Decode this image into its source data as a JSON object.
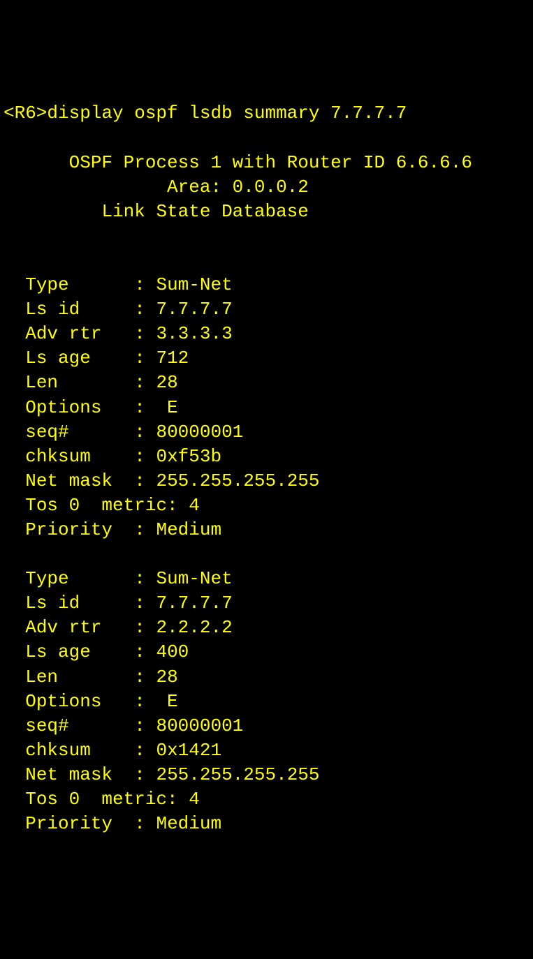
{
  "prompt": "<R6>display ospf lsdb summary 7.7.7.7",
  "header": {
    "process": "OSPF Process 1 with Router ID 6.6.6.6",
    "area": "Area: 0.0.0.2",
    "title": "Link State Database"
  },
  "entries": [
    {
      "type_label": "Type",
      "type_value": "Sum-Net",
      "lsid_label": "Ls id",
      "lsid_value": "7.7.7.7",
      "advrtr_label": "Adv rtr",
      "advrtr_value": "3.3.3.3",
      "lsage_label": "Ls age",
      "lsage_value": "712",
      "len_label": "Len",
      "len_value": "28",
      "options_label": "Options",
      "options_value": " E",
      "seq_label": "seq#",
      "seq_value": "80000001",
      "chksum_label": "chksum",
      "chksum_value": "0xf53b",
      "netmask_label": "Net mask",
      "netmask_value": "255.255.255.255",
      "tos_label": "Tos 0  metric: 4",
      "priority_label": "Priority",
      "priority_value": "Medium"
    },
    {
      "type_label": "Type",
      "type_value": "Sum-Net",
      "lsid_label": "Ls id",
      "lsid_value": "7.7.7.7",
      "advrtr_label": "Adv rtr",
      "advrtr_value": "2.2.2.2",
      "lsage_label": "Ls age",
      "lsage_value": "400",
      "len_label": "Len",
      "len_value": "28",
      "options_label": "Options",
      "options_value": " E",
      "seq_label": "seq#",
      "seq_value": "80000001",
      "chksum_label": "chksum",
      "chksum_value": "0x1421",
      "netmask_label": "Net mask",
      "netmask_value": "255.255.255.255",
      "tos_label": "Tos 0  metric: 4",
      "priority_label": "Priority",
      "priority_value": "Medium"
    }
  ]
}
